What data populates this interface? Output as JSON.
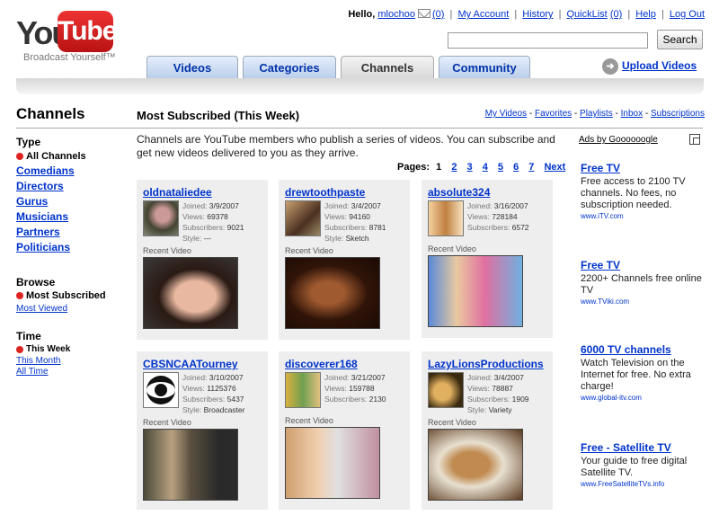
{
  "logo": {
    "you": "You",
    "tube": "Tube",
    "tagline": "Broadcast Yourself™"
  },
  "userbar": {
    "hello": "Hello,",
    "username": "mlochoo",
    "inbox_count": "(0)",
    "my_account": "My Account",
    "history": "History",
    "quicklist": "QuickList",
    "quicklist_count": "(0)",
    "help": "Help",
    "logout": "Log Out"
  },
  "search": {
    "button": "Search",
    "value": ""
  },
  "tabs": [
    {
      "label": "Videos"
    },
    {
      "label": "Categories"
    },
    {
      "label": "Channels"
    },
    {
      "label": "Community"
    }
  ],
  "upload": "Upload Videos",
  "sidebar": {
    "title": "Channels",
    "type_heading": "Type",
    "type_current": "All Channels",
    "types": [
      "Comedians",
      "Directors",
      "Gurus",
      "Musicians",
      "Partners",
      "Politicians"
    ],
    "browse_heading": "Browse",
    "browse_current": "Most Subscribed",
    "browse_other": "Most Viewed",
    "time_heading": "Time",
    "time_current": "This Week",
    "time_others": [
      "This Month",
      "All Time"
    ]
  },
  "main": {
    "title": "Most Subscribed (This Week)",
    "links": [
      "My Videos",
      "Favorites",
      "Playlists",
      "Inbox",
      "Subscriptions"
    ],
    "description": "Channels are YouTube members who publish a series of videos. You can subscribe and get new videos delivered to you as they arrive.",
    "pages_label": "Pages:",
    "pages": [
      "1",
      "2",
      "3",
      "4",
      "5",
      "6",
      "7"
    ],
    "next": "Next"
  },
  "labels": {
    "joined": "Joined:",
    "views": "Views:",
    "subscribers": "Subscribers:",
    "style": "Style:",
    "recent": "Recent Video"
  },
  "channels": [
    {
      "name": "oldnataliedee",
      "joined": "3/9/2007",
      "views": "69378",
      "subscribers": "9021",
      "style": "---"
    },
    {
      "name": "drewtoothpaste",
      "joined": "3/4/2007",
      "views": "94160",
      "subscribers": "8781",
      "style": "Sketch"
    },
    {
      "name": "absolute324",
      "joined": "3/16/2007",
      "views": "728184",
      "subscribers": "6572",
      "style": ""
    },
    {
      "name": "CBSNCAATourney",
      "joined": "3/10/2007",
      "views": "1125376",
      "subscribers": "5437",
      "style": "Broadcaster"
    },
    {
      "name": "discoverer168",
      "joined": "3/21/2007",
      "views": "159788",
      "subscribers": "2130",
      "style": ""
    },
    {
      "name": "LazyLionsProductions",
      "joined": "3/4/2007",
      "views": "78887",
      "subscribers": "1909",
      "style": "Variety"
    }
  ],
  "ads": {
    "header": "Ads by Goooooogle",
    "items": [
      {
        "title": "Free TV",
        "body": "Free access to 2100 TV channels. No fees, no subscription needed.",
        "url": "www.iTV.com"
      },
      {
        "title": "Free TV",
        "body": "2200+ Channels free online TV",
        "url": "www.TViki.com"
      },
      {
        "title": "6000 TV channels",
        "body": "Watch Television on the Internet for free. No extra charge!",
        "url": "www.global-itv.com"
      },
      {
        "title": "Free - Satellite TV",
        "body": "Your guide to free digital Satellite TV.",
        "url": "www.FreeSatelliteTVs.info"
      }
    ]
  }
}
